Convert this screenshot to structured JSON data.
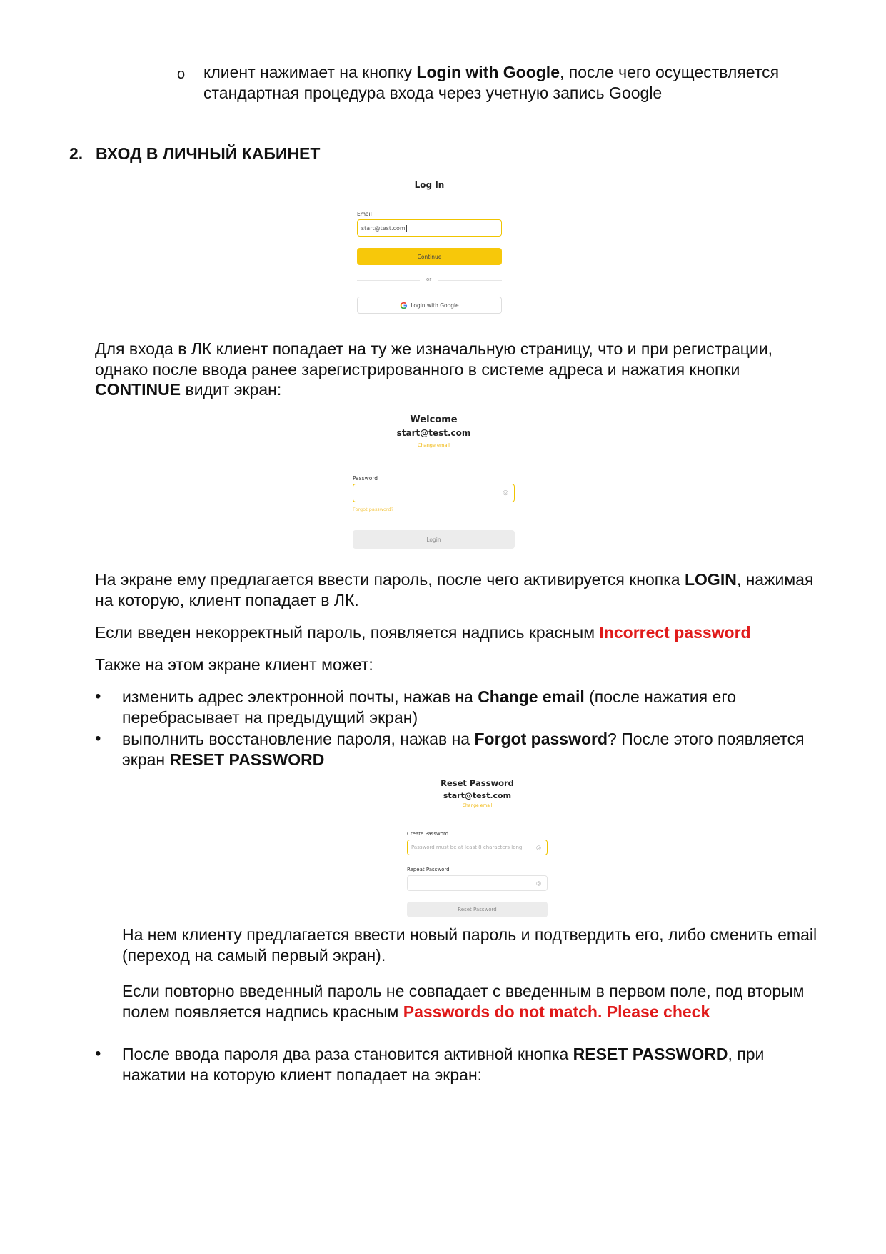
{
  "intro_bullet": {
    "marker": "o",
    "pre": "клиент нажимает на кнопку ",
    "bold": "Login with Google",
    "post1": ", после чего осуществляется",
    "line2": "стандартная процедура входа через учетную запись Google"
  },
  "section": {
    "number": "2.",
    "title": "ВХОД В ЛИЧНЫЙ КАБИНЕТ"
  },
  "login_screen": {
    "title": "Log In",
    "email_label": "Email",
    "email_value": "start@test.com",
    "continue_button": "Continue",
    "or_text": "or",
    "google_button": "Login with Google",
    "google_icon": "google-g-icon"
  },
  "para1": {
    "line1": "Для входа в ЛК клиент попадает на ту же изначальную страницу, что и при регистрации,",
    "line2": "однако после ввода ранее зарегистрированного в системе адреса и нажатия кнопки",
    "line3_bold": "CONTINUE",
    "line3_rest": " видит экран:"
  },
  "welcome_screen": {
    "title": "Welcome",
    "email": "start@test.com",
    "change_email": "Change email",
    "password_label": "Password",
    "eye_icon": "eye-off-icon",
    "forgot_password": "Forgot password?",
    "login_button": "Login"
  },
  "para2": {
    "line1_pre": "На экране ему предлагается ввести пароль, после чего активируется кнопка ",
    "line1_bold": "LOGIN",
    "line1_post": ", нажимая",
    "line2": "на которую, клиент попадает в ЛК."
  },
  "para3": {
    "pre": "Если введен некорректный пароль, появляется надпись красным ",
    "red": "Incorrect password"
  },
  "para4": "Также на этом экране клиент может:",
  "bullets": [
    {
      "line1_pre": "изменить адрес электронной почты, нажав на ",
      "line1_bold": "Change email",
      "line1_post": " (после нажатия его",
      "line2": "перебрасывает на предыдущий экран)"
    },
    {
      "line1_pre": "выполнить восстановление пароля, нажав на ",
      "line1_bold": "Forgot password",
      "line1_post": "? После этого появляется",
      "line2_pre": "экран ",
      "line2_bold": "RESET PASSWORD"
    }
  ],
  "reset_screen": {
    "title": "Reset Password",
    "email": "start@test.com",
    "change_email": "Change email",
    "create_label": "Create Password",
    "create_placeholder": "Password must be at least 8 characters long",
    "repeat_label": "Repeat Password",
    "reset_button": "Reset Password"
  },
  "para5": {
    "line1": "На нем клиенту предлагается ввести новый пароль и подтвердить его, либо сменить email",
    "line2": "(переход на самый первый экран)."
  },
  "para6": {
    "line1": "Если повторно введенный пароль не совпадает с введенным в первом поле, под вторым",
    "line2_pre": "полем появляется надпись красным ",
    "line2_red": "Passwords do not match. Please check"
  },
  "final_bullet": {
    "line1_pre": "После ввода пароля два раза становится активной кнопка ",
    "line1_bold": "RESET PASSWORD",
    "line1_post": ", при",
    "line2": "нажатии на которую клиент попадает на экран:"
  }
}
